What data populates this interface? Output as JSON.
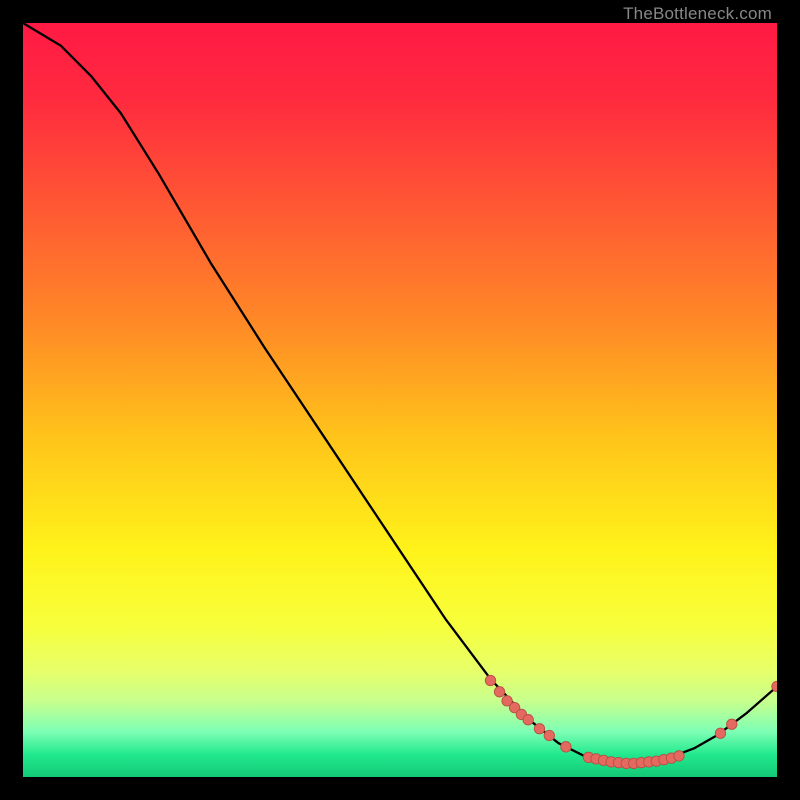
{
  "watermark": "TheBottleneck.com",
  "colors": {
    "plot_bg_stops": [
      {
        "offset": 0.0,
        "color": "#ff1a44"
      },
      {
        "offset": 0.1,
        "color": "#ff2a3f"
      },
      {
        "offset": 0.25,
        "color": "#ff5a33"
      },
      {
        "offset": 0.4,
        "color": "#ff8a26"
      },
      {
        "offset": 0.55,
        "color": "#ffc41a"
      },
      {
        "offset": 0.7,
        "color": "#fff31a"
      },
      {
        "offset": 0.8,
        "color": "#f7ff3c"
      },
      {
        "offset": 0.86,
        "color": "#e6ff6a"
      },
      {
        "offset": 0.9,
        "color": "#c7ff8e"
      },
      {
        "offset": 0.94,
        "color": "#7dffb5"
      },
      {
        "offset": 0.97,
        "color": "#22e98d"
      },
      {
        "offset": 1.0,
        "color": "#13c976"
      }
    ],
    "line": "#000000",
    "marker_fill": "#e46a60",
    "marker_stroke": "#b84f45"
  },
  "chart_data": {
    "type": "line",
    "title": "",
    "xlabel": "",
    "ylabel": "",
    "xlim": [
      0,
      100
    ],
    "ylim": [
      0,
      100
    ],
    "curve_points": [
      {
        "x": 0,
        "y": 100
      },
      {
        "x": 5,
        "y": 97
      },
      {
        "x": 9,
        "y": 93
      },
      {
        "x": 13,
        "y": 88
      },
      {
        "x": 18,
        "y": 80
      },
      {
        "x": 25,
        "y": 68
      },
      {
        "x": 32,
        "y": 57
      },
      {
        "x": 40,
        "y": 45
      },
      {
        "x": 48,
        "y": 33
      },
      {
        "x": 56,
        "y": 21
      },
      {
        "x": 62,
        "y": 13
      },
      {
        "x": 67,
        "y": 7.7
      },
      {
        "x": 71,
        "y": 4.5
      },
      {
        "x": 75,
        "y": 2.5
      },
      {
        "x": 80,
        "y": 1.8
      },
      {
        "x": 85,
        "y": 2.3
      },
      {
        "x": 89,
        "y": 3.8
      },
      {
        "x": 92,
        "y": 5.5
      },
      {
        "x": 96,
        "y": 8.5
      },
      {
        "x": 100,
        "y": 12
      }
    ],
    "markers": [
      {
        "x": 62.0,
        "y": 12.8
      },
      {
        "x": 63.2,
        "y": 11.3
      },
      {
        "x": 64.2,
        "y": 10.1
      },
      {
        "x": 65.2,
        "y": 9.2
      },
      {
        "x": 66.1,
        "y": 8.3
      },
      {
        "x": 67.0,
        "y": 7.6
      },
      {
        "x": 68.5,
        "y": 6.4
      },
      {
        "x": 69.8,
        "y": 5.5
      },
      {
        "x": 72.0,
        "y": 4.0
      },
      {
        "x": 75.0,
        "y": 2.6
      },
      {
        "x": 76.0,
        "y": 2.4
      },
      {
        "x": 77.0,
        "y": 2.2
      },
      {
        "x": 78.0,
        "y": 2.0
      },
      {
        "x": 79.0,
        "y": 1.9
      },
      {
        "x": 80.0,
        "y": 1.8
      },
      {
        "x": 81.0,
        "y": 1.8
      },
      {
        "x": 82.0,
        "y": 1.9
      },
      {
        "x": 83.0,
        "y": 2.0
      },
      {
        "x": 84.0,
        "y": 2.1
      },
      {
        "x": 85.0,
        "y": 2.3
      },
      {
        "x": 86.0,
        "y": 2.5
      },
      {
        "x": 87.0,
        "y": 2.8
      },
      {
        "x": 92.5,
        "y": 5.8
      },
      {
        "x": 94.0,
        "y": 7.0
      },
      {
        "x": 100.0,
        "y": 12.0
      }
    ],
    "marker_radius": 5.2
  }
}
